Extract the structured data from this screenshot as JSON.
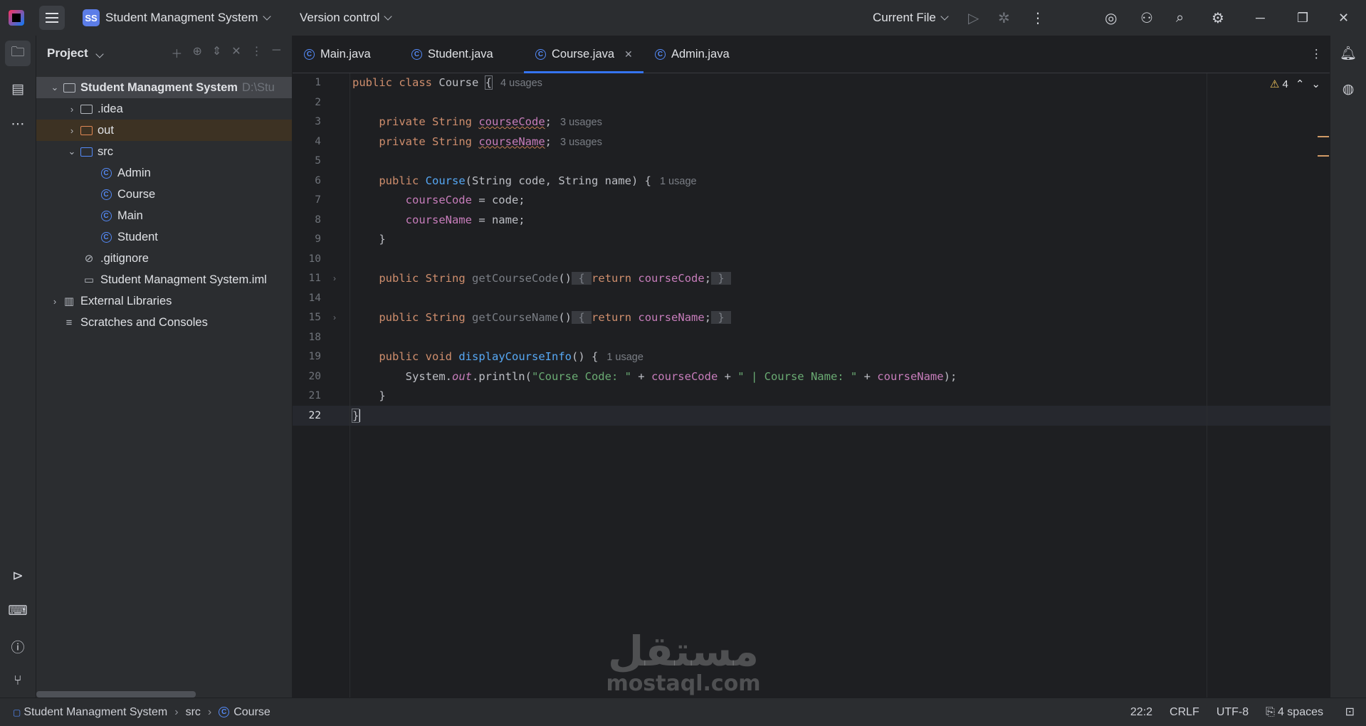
{
  "titlebar": {
    "project_badge": "SS",
    "project_name": "Student Managment System",
    "vcs_label": "Version control",
    "run_config": "Current File"
  },
  "project_panel": {
    "title": "Project",
    "tree": [
      {
        "label": "Student Managment System",
        "suffix": "D:\\Stu",
        "icon": "module-folder-icon"
      },
      {
        "label": ".idea",
        "icon": "folder-icon"
      },
      {
        "label": "out",
        "icon": "folder-icon"
      },
      {
        "label": "src",
        "icon": "source-folder-icon"
      },
      {
        "label": "Admin",
        "icon": "class-icon"
      },
      {
        "label": "Course",
        "icon": "class-icon"
      },
      {
        "label": "Main",
        "icon": "main-class-icon"
      },
      {
        "label": "Student",
        "icon": "class-icon"
      },
      {
        "label": ".gitignore",
        "icon": "ignore-file-icon"
      },
      {
        "label": "Student Managment System.iml",
        "icon": "iml-file-icon"
      },
      {
        "label": "External Libraries",
        "icon": "library-icon"
      },
      {
        "label": "Scratches and Consoles",
        "icon": "scratches-icon"
      }
    ]
  },
  "tabs": [
    {
      "label": "Main.java"
    },
    {
      "label": "Student.java"
    },
    {
      "label": "Course.java",
      "active": true
    },
    {
      "label": "Admin.java"
    }
  ],
  "editor": {
    "warning_count": "4",
    "line_numbers": [
      "1",
      "2",
      "3",
      "4",
      "5",
      "6",
      "7",
      "8",
      "9",
      "10",
      "11",
      "14",
      "15",
      "18",
      "19",
      "20",
      "21",
      "22"
    ],
    "hints": {
      "class_usages": "4 usages",
      "code_usages": "3 usages",
      "name_usages": "3 usages",
      "ctor_usages": "1 usage",
      "display_usages": "1 usage"
    },
    "tokens": {
      "public": "public",
      "class": "class",
      "Course": "Course",
      "lbrace": "{",
      "rbrace": "}",
      "private": "private",
      "String": "String",
      "courseCode": "courseCode",
      "courseName": "courseName",
      "semi": ";",
      "ctor_params": "(String code, String name) {",
      "assign_code": " = code;",
      "assign_name": " = name;",
      "getCourseCode": "getCourseCode",
      "getCourseName": "getCourseName",
      "parens": "()",
      "return": "return",
      "void": "void",
      "displayCourseInfo": "displayCourseInfo",
      "display_tail": "() {",
      "System": "System.",
      "out": "out",
      "println": ".println(",
      "str1": "\"Course Code: \"",
      "plus": " + ",
      "str2": "\" | Course Name: \"",
      "close": ");"
    }
  },
  "statusbar": {
    "breadcrumb": [
      "Student Managment System",
      "src",
      "Course"
    ],
    "position": "22:2",
    "line_sep": "CRLF",
    "encoding": "UTF-8",
    "indent": "4 spaces"
  },
  "watermark": {
    "arabic": "مستقل",
    "latin": "mostaql.com"
  }
}
